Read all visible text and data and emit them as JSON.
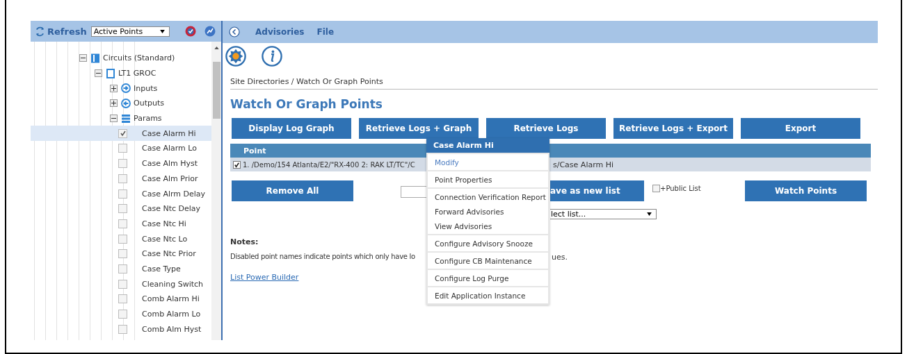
{
  "sidebar": {
    "refresh_label": "Refresh",
    "filter": {
      "value": "Active Points"
    },
    "tree": [
      {
        "kind": "folder",
        "label": "Circuits (Standard)",
        "expanded": true,
        "children": [
          {
            "kind": "folder",
            "label": "LT1 GROC",
            "expanded": true,
            "children": [
              {
                "kind": "folder",
                "label": "Inputs",
                "expanded": false
              },
              {
                "kind": "folder",
                "label": "Outputs",
                "expanded": false
              },
              {
                "kind": "folder",
                "label": "Params",
                "expanded": true,
                "children": [
                  {
                    "kind": "point",
                    "label": "Case Alarm Hi",
                    "checked": true,
                    "selected": true
                  },
                  {
                    "kind": "point",
                    "label": "Case Alarm Lo",
                    "checked": false,
                    "selected": false
                  },
                  {
                    "kind": "point",
                    "label": "Case Alm Hyst",
                    "checked": false,
                    "selected": false
                  },
                  {
                    "kind": "point",
                    "label": "Case Alm Prior",
                    "checked": false,
                    "selected": false
                  },
                  {
                    "kind": "point",
                    "label": "Case Alrm Delay",
                    "checked": false,
                    "selected": false
                  },
                  {
                    "kind": "point",
                    "label": "Case Ntc Delay",
                    "checked": false,
                    "selected": false
                  },
                  {
                    "kind": "point",
                    "label": "Case Ntc Hi",
                    "checked": false,
                    "selected": false
                  },
                  {
                    "kind": "point",
                    "label": "Case Ntc Lo",
                    "checked": false,
                    "selected": false
                  },
                  {
                    "kind": "point",
                    "label": "Case Ntc Prior",
                    "checked": false,
                    "selected": false
                  },
                  {
                    "kind": "point",
                    "label": "Case Type",
                    "checked": false,
                    "selected": false
                  },
                  {
                    "kind": "point",
                    "label": "Cleaning Switch",
                    "checked": false,
                    "selected": false
                  },
                  {
                    "kind": "point",
                    "label": "Comb Alarm Hi",
                    "checked": false,
                    "selected": false
                  },
                  {
                    "kind": "point",
                    "label": "Comb Alarm Lo",
                    "checked": false,
                    "selected": false
                  },
                  {
                    "kind": "point",
                    "label": "Comb Alm Hyst",
                    "checked": false,
                    "selected": false
                  }
                ]
              }
            ]
          }
        ]
      }
    ]
  },
  "menu": [
    "Advisories",
    "File"
  ],
  "breadcrumb": "Site Directories / Watch Or Graph Points",
  "heading": "Watch Or Graph Points",
  "actions": [
    "Display Log Graph",
    "Retrieve Logs + Graph",
    "Retrieve Logs",
    "Retrieve Logs + Export",
    "Export"
  ],
  "table": {
    "columns": [
      "Point"
    ],
    "rows": [
      {
        "checked": true,
        "text_left": "1. /Demo/154 Atlanta/E2/\"RX-400 2: RAK LT/TC\"/C",
        "text_right": "s/Case Alarm Hi"
      }
    ]
  },
  "list_controls": {
    "remove_all": "Remove All",
    "save_button": "ave as new list",
    "public_list": {
      "label": "+Public List",
      "checked": false
    },
    "watch_points": "Watch Points",
    "list_select": {
      "value": "lect list..."
    }
  },
  "notes": {
    "title": "Notes:",
    "text_left": "Disabled point names indicate points which only have lo",
    "text_right": "ues.",
    "link": "List Power Builder"
  },
  "context_menu": {
    "title": "Case Alarm Hi",
    "groups": [
      [
        {
          "label": "Modify",
          "kind": "link"
        }
      ],
      [
        {
          "label": "Point Properties",
          "kind": "item"
        }
      ],
      [
        {
          "label": "Connection Verification Report",
          "kind": "item"
        },
        {
          "label": "Forward Advisories",
          "kind": "item"
        },
        {
          "label": "View Advisories",
          "kind": "item"
        }
      ],
      [
        {
          "label": "Configure Advisory Snooze",
          "kind": "item"
        }
      ],
      [
        {
          "label": "Configure CB Maintenance",
          "kind": "item"
        }
      ],
      [
        {
          "label": "Configure Log Purge",
          "kind": "item"
        }
      ],
      [
        {
          "label": "Edit Application Instance",
          "kind": "item"
        }
      ]
    ]
  }
}
